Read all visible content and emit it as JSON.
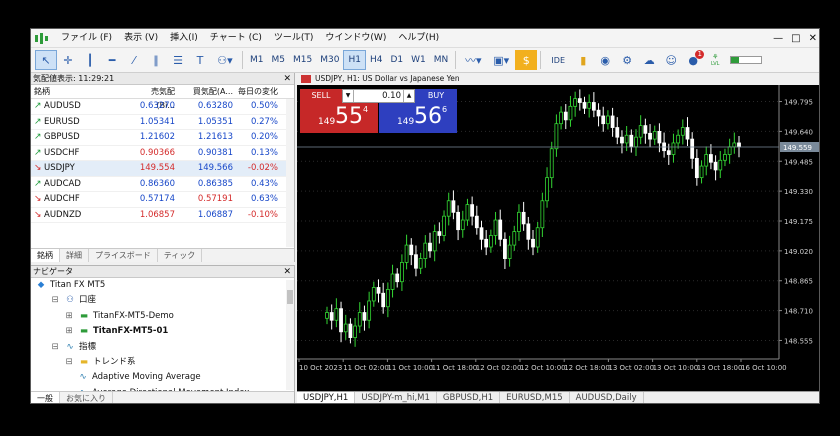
{
  "menu": {
    "items": [
      "ファイル (F)",
      "表示 (V)",
      "挿入(I)",
      "チャート (C)",
      "ツール(T)",
      "ウインドウ(W)",
      "ヘルプ(H)"
    ],
    "window_controls": [
      "—",
      "□",
      "✕"
    ]
  },
  "toolbar": {
    "timeframes": [
      "M1",
      "M5",
      "M15",
      "M30",
      "H1",
      "H4",
      "D1",
      "W1",
      "MN"
    ],
    "selected_timeframe": "H1",
    "ide_label": "IDE",
    "notification_count": "1",
    "level_label": "LVL"
  },
  "market_watch": {
    "title": "気配値表示: 11:29:21",
    "columns": [
      "銘柄",
      "売気配(Bi...",
      "買気配(A...",
      "毎日の変化"
    ],
    "rows": [
      {
        "symbol": "AUDUSD",
        "bid": "0.63270",
        "ask": "0.63280",
        "change": "0.50%",
        "dir": "up",
        "bid_color": "blue",
        "ask_color": "blue",
        "change_color": "blue"
      },
      {
        "symbol": "EURUSD",
        "bid": "1.05341",
        "ask": "1.05351",
        "change": "0.27%",
        "dir": "up",
        "bid_color": "blue",
        "ask_color": "blue",
        "change_color": "blue"
      },
      {
        "symbol": "GBPUSD",
        "bid": "1.21602",
        "ask": "1.21613",
        "change": "0.20%",
        "dir": "up",
        "bid_color": "blue",
        "ask_color": "blue",
        "change_color": "blue"
      },
      {
        "symbol": "USDCHF",
        "bid": "0.90366",
        "ask": "0.90381",
        "change": "0.13%",
        "dir": "up",
        "bid_color": "red",
        "ask_color": "blue",
        "change_color": "blue"
      },
      {
        "symbol": "USDJPY",
        "bid": "149.554",
        "ask": "149.566",
        "change": "-0.02%",
        "dir": "down",
        "bid_color": "red",
        "ask_color": "blue",
        "change_color": "red"
      },
      {
        "symbol": "AUDCAD",
        "bid": "0.86360",
        "ask": "0.86385",
        "change": "0.43%",
        "dir": "up",
        "bid_color": "blue",
        "ask_color": "blue",
        "change_color": "blue"
      },
      {
        "symbol": "AUDCHF",
        "bid": "0.57174",
        "ask": "0.57191",
        "change": "0.63%",
        "dir": "down",
        "bid_color": "blue",
        "ask_color": "red",
        "change_color": "blue"
      },
      {
        "symbol": "AUDNZD",
        "bid": "1.06857",
        "ask": "1.06887",
        "change": "-0.10%",
        "dir": "down",
        "bid_color": "red",
        "ask_color": "blue",
        "change_color": "red"
      }
    ],
    "tabs": [
      "銘柄",
      "詳細",
      "プライスボード",
      "ティック"
    ]
  },
  "navigator": {
    "title": "ナビゲータ",
    "items": [
      {
        "label": "Titan FX MT5",
        "level": 0,
        "icon": "broker-icon",
        "bold": false
      },
      {
        "label": "口座",
        "level": 1,
        "icon": "accounts-icon",
        "bold": false,
        "expander": "⊟"
      },
      {
        "label": "TitanFX-MT5-Demo",
        "level": 2,
        "icon": "account-icon",
        "bold": false,
        "expander": "⊞"
      },
      {
        "label": "TitanFX-MT5-01",
        "level": 2,
        "icon": "account-icon",
        "bold": true,
        "expander": "⊞"
      },
      {
        "label": "指標",
        "level": 1,
        "icon": "indicator-icon",
        "bold": false,
        "expander": "⊟"
      },
      {
        "label": "トレンド系",
        "level": 2,
        "icon": "folder-icon",
        "bold": false,
        "expander": "⊟"
      },
      {
        "label": "Adaptive Moving Average",
        "level": 3,
        "icon": "indicator-icon",
        "bold": false
      },
      {
        "label": "Average Directional Movement Index",
        "level": 3,
        "icon": "indicator-icon",
        "bold": false
      },
      {
        "label": "Average Directional Movement Index Wilder",
        "level": 3,
        "icon": "indicator-icon",
        "bold": false
      }
    ],
    "tabs": [
      "一般",
      "お気に入り"
    ]
  },
  "chart": {
    "title": "USDJPY, H1:  US Dollar vs Japanese Yen",
    "sell_label": "SELL",
    "buy_label": "BUY",
    "lot": "0.10",
    "sell_price_small": "149",
    "sell_price_big": "55",
    "sell_price_sup": "4",
    "buy_price_small": "149",
    "buy_price_big": "56",
    "buy_price_sup": "6",
    "tabs": [
      "USDJPY,H1",
      "USDJPY-m_hi,M1",
      "GBPUSD,H1",
      "EURUSD,M15",
      "AUDUSD,Daily"
    ],
    "colors": {
      "bull": "#33d633",
      "bear": "#ffffff",
      "grid": "#2a2a2a",
      "axis": "#cfcfcf"
    }
  },
  "chart_data": {
    "type": "candlestick",
    "y_ticks": [
      "149.795",
      "149.640",
      "149.485",
      "149.330",
      "149.175",
      "149.020",
      "148.865",
      "148.710",
      "148.555"
    ],
    "x_ticks": [
      "10 Oct 2023",
      "11 Oct 02:00",
      "11 Oct 10:00",
      "11 Oct 18:00",
      "12 Oct 02:00",
      "12 Oct 10:00",
      "12 Oct 18:00",
      "13 Oct 02:00",
      "13 Oct 10:00",
      "13 Oct 18:00",
      "16 Oct 10:00"
    ],
    "ylim": [
      148.49,
      149.86
    ],
    "current_price": "149.559",
    "closes": [
      148.7,
      148.66,
      148.72,
      148.6,
      148.64,
      148.57,
      148.63,
      148.7,
      148.66,
      148.76,
      148.83,
      148.8,
      148.73,
      148.82,
      148.9,
      148.86,
      148.96,
      149.05,
      149.0,
      148.93,
      148.98,
      149.06,
      149.02,
      149.12,
      149.1,
      149.2,
      149.28,
      149.22,
      149.13,
      149.18,
      149.26,
      149.2,
      149.14,
      149.08,
      149.04,
      149.1,
      149.18,
      149.08,
      148.98,
      149.05,
      149.12,
      149.22,
      149.16,
      149.08,
      149.04,
      149.14,
      149.28,
      149.4,
      149.55,
      149.68,
      149.74,
      149.7,
      149.77,
      149.81,
      149.79,
      149.76,
      149.79,
      149.75,
      149.72,
      149.68,
      149.72,
      149.66,
      149.61,
      149.58,
      149.62,
      149.56,
      149.61,
      149.67,
      149.63,
      149.6,
      149.64,
      149.58,
      149.54,
      149.52,
      149.58,
      149.62,
      149.66,
      149.6,
      149.5,
      149.4,
      149.46,
      149.52,
      149.48,
      149.44,
      149.49,
      149.52,
      149.56,
      149.58,
      149.56
    ],
    "series": [
      {
        "name": "USDJPY, H1"
      }
    ]
  }
}
